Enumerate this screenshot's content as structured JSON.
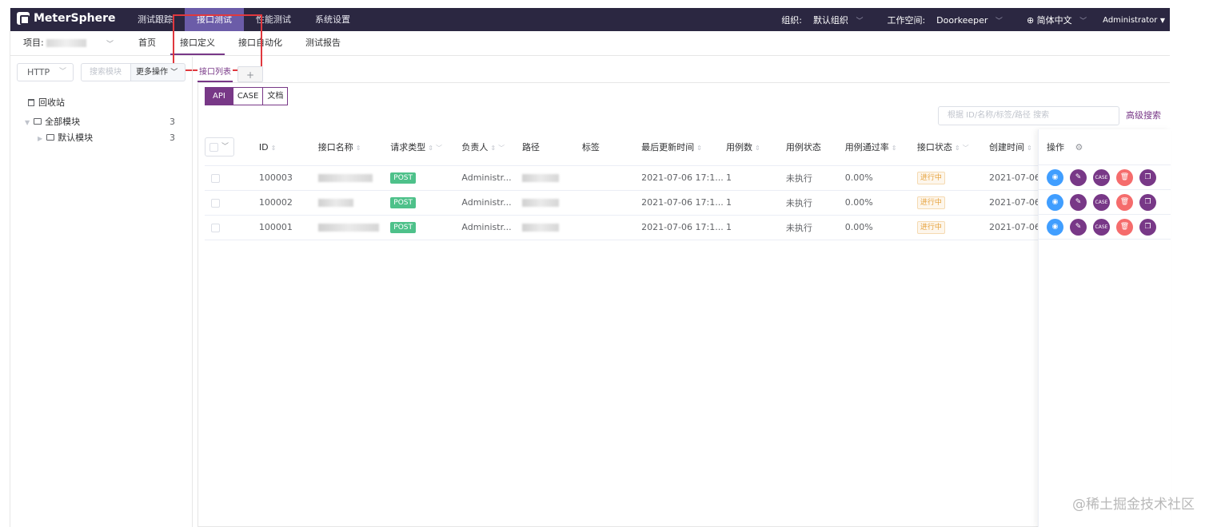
{
  "app": {
    "name": "MeterSphere"
  },
  "topnav": {
    "items": [
      "测试跟踪",
      "接口测试",
      "性能测试",
      "系统设置"
    ],
    "org_label": "组织:",
    "org_value": "默认组织",
    "workspace_label": "工作空间:",
    "workspace_value": "Doorkeeper",
    "language": "简体中文",
    "user": "Administrator"
  },
  "subnav": {
    "project_label": "项目:",
    "items": [
      "首页",
      "接口定义",
      "接口自动化",
      "测试报告"
    ]
  },
  "sidebar": {
    "protocol": "HTTP",
    "search_placeholder": "搜索模块",
    "more_ops": "更多操作",
    "recycle": "回收站",
    "all_modules": "全部模块",
    "all_count": "3",
    "default_module": "默认模块",
    "default_count": "3"
  },
  "main": {
    "tab_list": "接口列表",
    "tab_add": "+",
    "seg": [
      "API",
      "CASE",
      "文档"
    ],
    "search_placeholder": "根据 ID/名称/标签/路径 搜索",
    "advanced": "高级搜索"
  },
  "table": {
    "headers": [
      "ID",
      "接口名称",
      "请求类型",
      "负责人",
      "路径",
      "标签",
      "最后更新时间",
      "用例数",
      "用例状态",
      "用例通过率",
      "接口状态",
      "创建时间"
    ],
    "ops_header": "操作",
    "rows": [
      {
        "id": "100003",
        "method": "POST",
        "owner": "Administr...",
        "updated": "2021-07-06 17:1...",
        "cases": "1",
        "case_status": "未执行",
        "pass_rate": "0.00%",
        "status": "进行中",
        "created": "2021-07-06"
      },
      {
        "id": "100002",
        "method": "POST",
        "owner": "Administr...",
        "updated": "2021-07-06 17:1...",
        "cases": "1",
        "case_status": "未执行",
        "pass_rate": "0.00%",
        "status": "进行中",
        "created": "2021-07-06"
      },
      {
        "id": "100001",
        "method": "POST",
        "owner": "Administr...",
        "updated": "2021-07-06 17:1...",
        "cases": "1",
        "case_status": "未执行",
        "pass_rate": "0.00%",
        "status": "进行中",
        "created": "2021-07-06"
      }
    ],
    "case_icon_label": "CASE"
  },
  "watermark": "@稀土掘金技术社区",
  "colors": {
    "brand": "#783887",
    "topbar": "#2b2741",
    "highlight": "#e0383e"
  }
}
